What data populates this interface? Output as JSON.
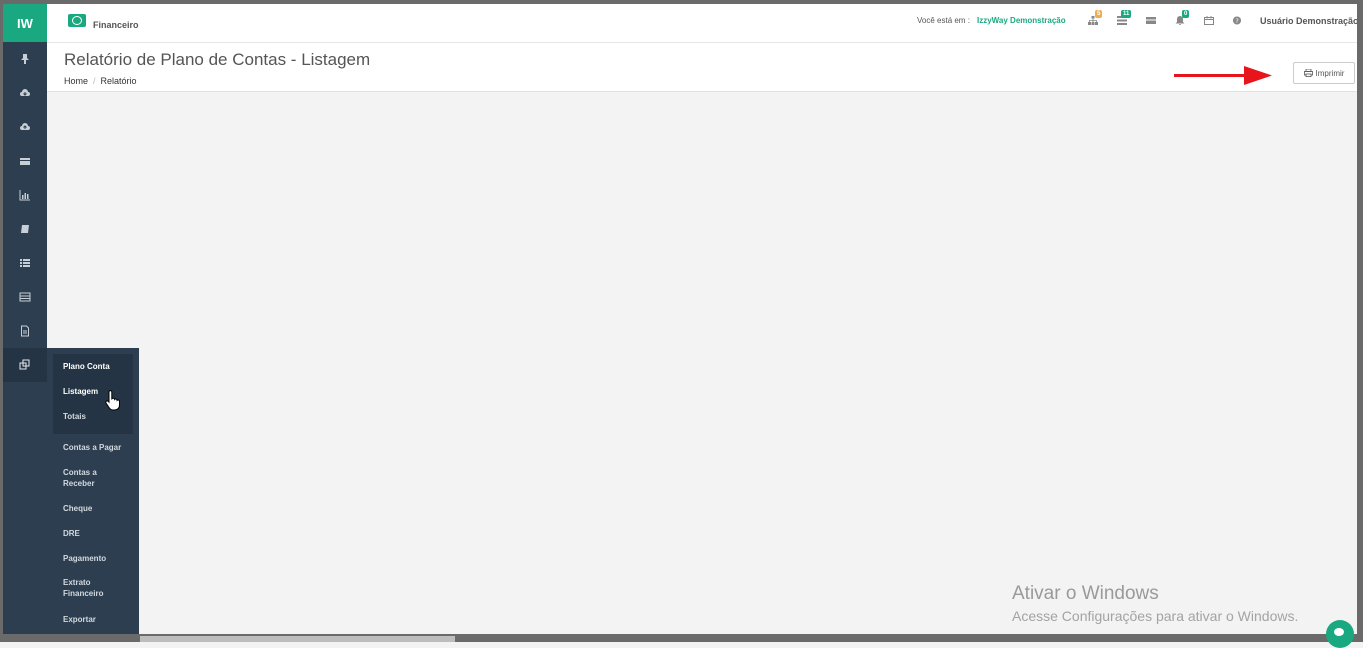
{
  "app": {
    "logo": "IW",
    "module": "Financeiro"
  },
  "topbar": {
    "where_label": "Você está em :",
    "where_value": "IzzyWay Demonstração",
    "icons": [
      {
        "name": "sitemap-icon",
        "badge": "5",
        "badge_color": "#f0ad4e"
      },
      {
        "name": "tasks-icon",
        "badge": "11",
        "badge_color": "#1aa881"
      },
      {
        "name": "messages-icon",
        "badge": "",
        "badge_color": ""
      },
      {
        "name": "bell-icon",
        "badge": "0",
        "badge_color": "#1aa881"
      },
      {
        "name": "calendar-icon",
        "badge": "",
        "badge_color": ""
      },
      {
        "name": "help-icon",
        "badge": "",
        "badge_color": ""
      }
    ],
    "user": "Usuário Demonstração"
  },
  "page": {
    "title": "Relatório de Plano de Contas - Listagem",
    "breadcrumb": [
      "Home",
      "Relatório"
    ],
    "print_label": "Imprimir"
  },
  "sidebar": {
    "icons": [
      "pin-icon",
      "cloud-download-icon",
      "cloud-upload-icon",
      "card-icon",
      "bar-chart-icon",
      "book-icon",
      "list-icon",
      "table-icon",
      "document-icon",
      "copy-icon"
    ]
  },
  "submenu": {
    "items": [
      "Plano Conta",
      "Listagem",
      "Totais",
      "Contas a Pagar",
      "Contas a Receber",
      "Cheque",
      "DRE",
      "Pagamento",
      "Extrato Financeiro",
      "Exportar"
    ]
  },
  "windows_notice": {
    "title": "Ativar o Windows",
    "subtitle": "Acesse Configurações para ativar o Windows."
  },
  "colors": {
    "accent": "#1aa881",
    "sidebar": "#2c3e50",
    "arrow": "#e8141b"
  }
}
